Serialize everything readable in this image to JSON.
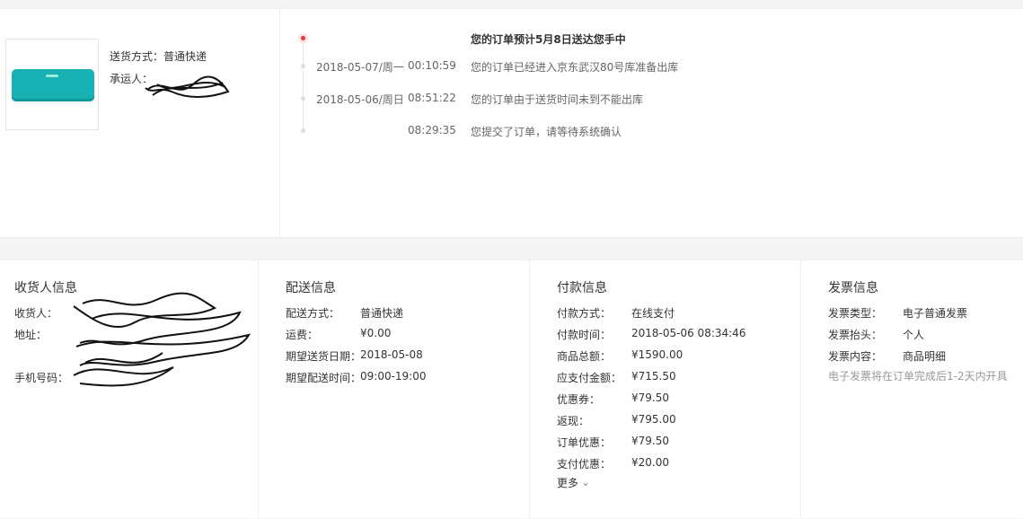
{
  "goods": {
    "shipping_label": "送货方式：普通快递",
    "carrier_label": "承运人：",
    "carrier_value": "XXXXXXXXXXXX",
    "product_color": "#18b1b3"
  },
  "timeline": {
    "accent_color": "#e4393c",
    "steps": [
      {
        "date": "",
        "time": "",
        "text": "您的订单预计5月8日送达您手中"
      },
      {
        "date": "2018-05-07/周一",
        "time": "00:10:59",
        "text": "您的订单已经进入京东武汉80号库准备出库"
      },
      {
        "date": "2018-05-06/周日",
        "time": "08:51:22",
        "text": "您的订单由于送货时间未到不能出库"
      },
      {
        "date": "",
        "time": "08:29:35",
        "text": "您提交了订单，请等待系统确认"
      }
    ]
  },
  "receiver": {
    "title": "收货人信息",
    "name_label": "收货人：",
    "name_value": "XXXXXX",
    "address_label": "地址：",
    "address_value": "XXXXXXXXXXXXXXXXXXXXXXXX",
    "phone_label": "手机号码：",
    "phone_value": "XXXXXXXXXXX"
  },
  "delivery": {
    "title": "配送信息",
    "method_label": "配送方式：",
    "method_value": "普通快递",
    "fee_label": "运费：",
    "fee_value": "¥0.00",
    "expected_date_label": "期望送货日期：",
    "expected_date_value": "2018-05-08",
    "expected_time_label": "期望配送时间：",
    "expected_time_value": "09:00-19:00"
  },
  "payment": {
    "title": "付款信息",
    "method_label": "付款方式：",
    "method_value": "在线支付",
    "time_label": "付款时间：",
    "time_value": "2018-05-06 08:34:46",
    "total_label": "商品总额：",
    "total_value": "¥1590.00",
    "payable_label": "应支付金额：",
    "payable_value": "¥715.50",
    "coupon_label": "优惠券：",
    "coupon_value": "¥79.50",
    "cashback_label": "返现：",
    "cashback_value": "¥795.00",
    "order_discount_label": "订单优惠：",
    "order_discount_value": "¥79.50",
    "pay_discount_label": "支付优惠：",
    "pay_discount_value": "¥20.00",
    "more_label": "更多"
  },
  "invoice": {
    "title": "发票信息",
    "type_label": "发票类型：",
    "type_value": "电子普通发票",
    "header_label": "发票抬头：",
    "header_value": "个人",
    "content_label": "发票内容：",
    "content_value": "商品明细",
    "note": "电子发票将在订单完成后1-2天内开具"
  }
}
